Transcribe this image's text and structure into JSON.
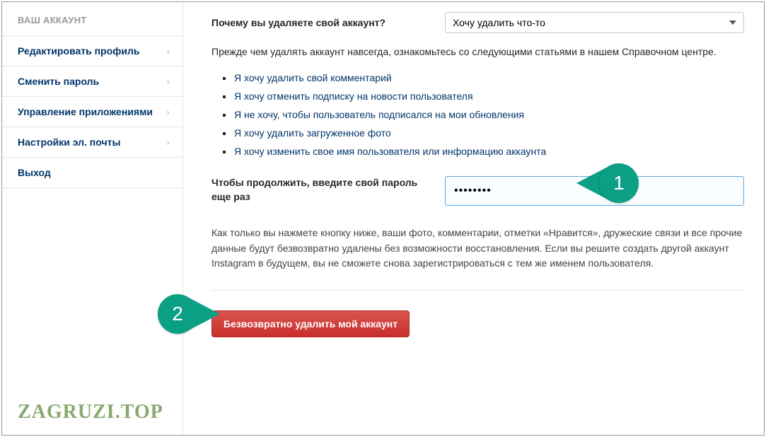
{
  "sidebar": {
    "header": "ВАШ АККАУНТ",
    "items": [
      {
        "label": "Редактировать профиль",
        "chev": true
      },
      {
        "label": "Сменить пароль",
        "chev": true
      },
      {
        "label": "Управление приложениями",
        "chev": true
      },
      {
        "label": "Настройки эл. почты",
        "chev": true
      },
      {
        "label": "Выход",
        "chev": false
      }
    ]
  },
  "main": {
    "question_label": "Почему вы удаляете свой аккаунт?",
    "select_value": "Хочу удалить что-то",
    "intro": "Прежде чем удалять аккаунт навсегда, ознакомьтесь со следующими статьями в нашем Справочном центре.",
    "help_links": [
      "Я хочу удалить свой комментарий",
      "Я хочу отменить подписку на новости пользователя",
      "Я не хочу, чтобы пользователь подписался на мои обновления",
      "Я хочу удалить загруженное фото",
      "Я хочу изменить свое имя пользователя или информацию аккаунта"
    ],
    "password_label": "Чтобы продолжить, введите свой пароль еще раз",
    "password_value": "••••••••",
    "warning": "Как только вы нажмете кнопку ниже, ваши фото, комментарии, отметки «Нравится», дружеские связи и все прочие данные будут безвозвратно удалены без возможности восстановления. Если вы решите создать другой аккаунт Instagram в будущем, вы не сможете снова зарегистрироваться с тем же именем пользователя.",
    "delete_button": "Безвозвратно удалить мой аккаунт"
  },
  "callouts": {
    "one": "1",
    "two": "2"
  },
  "watermark": "ZAGRUZI.TOP"
}
